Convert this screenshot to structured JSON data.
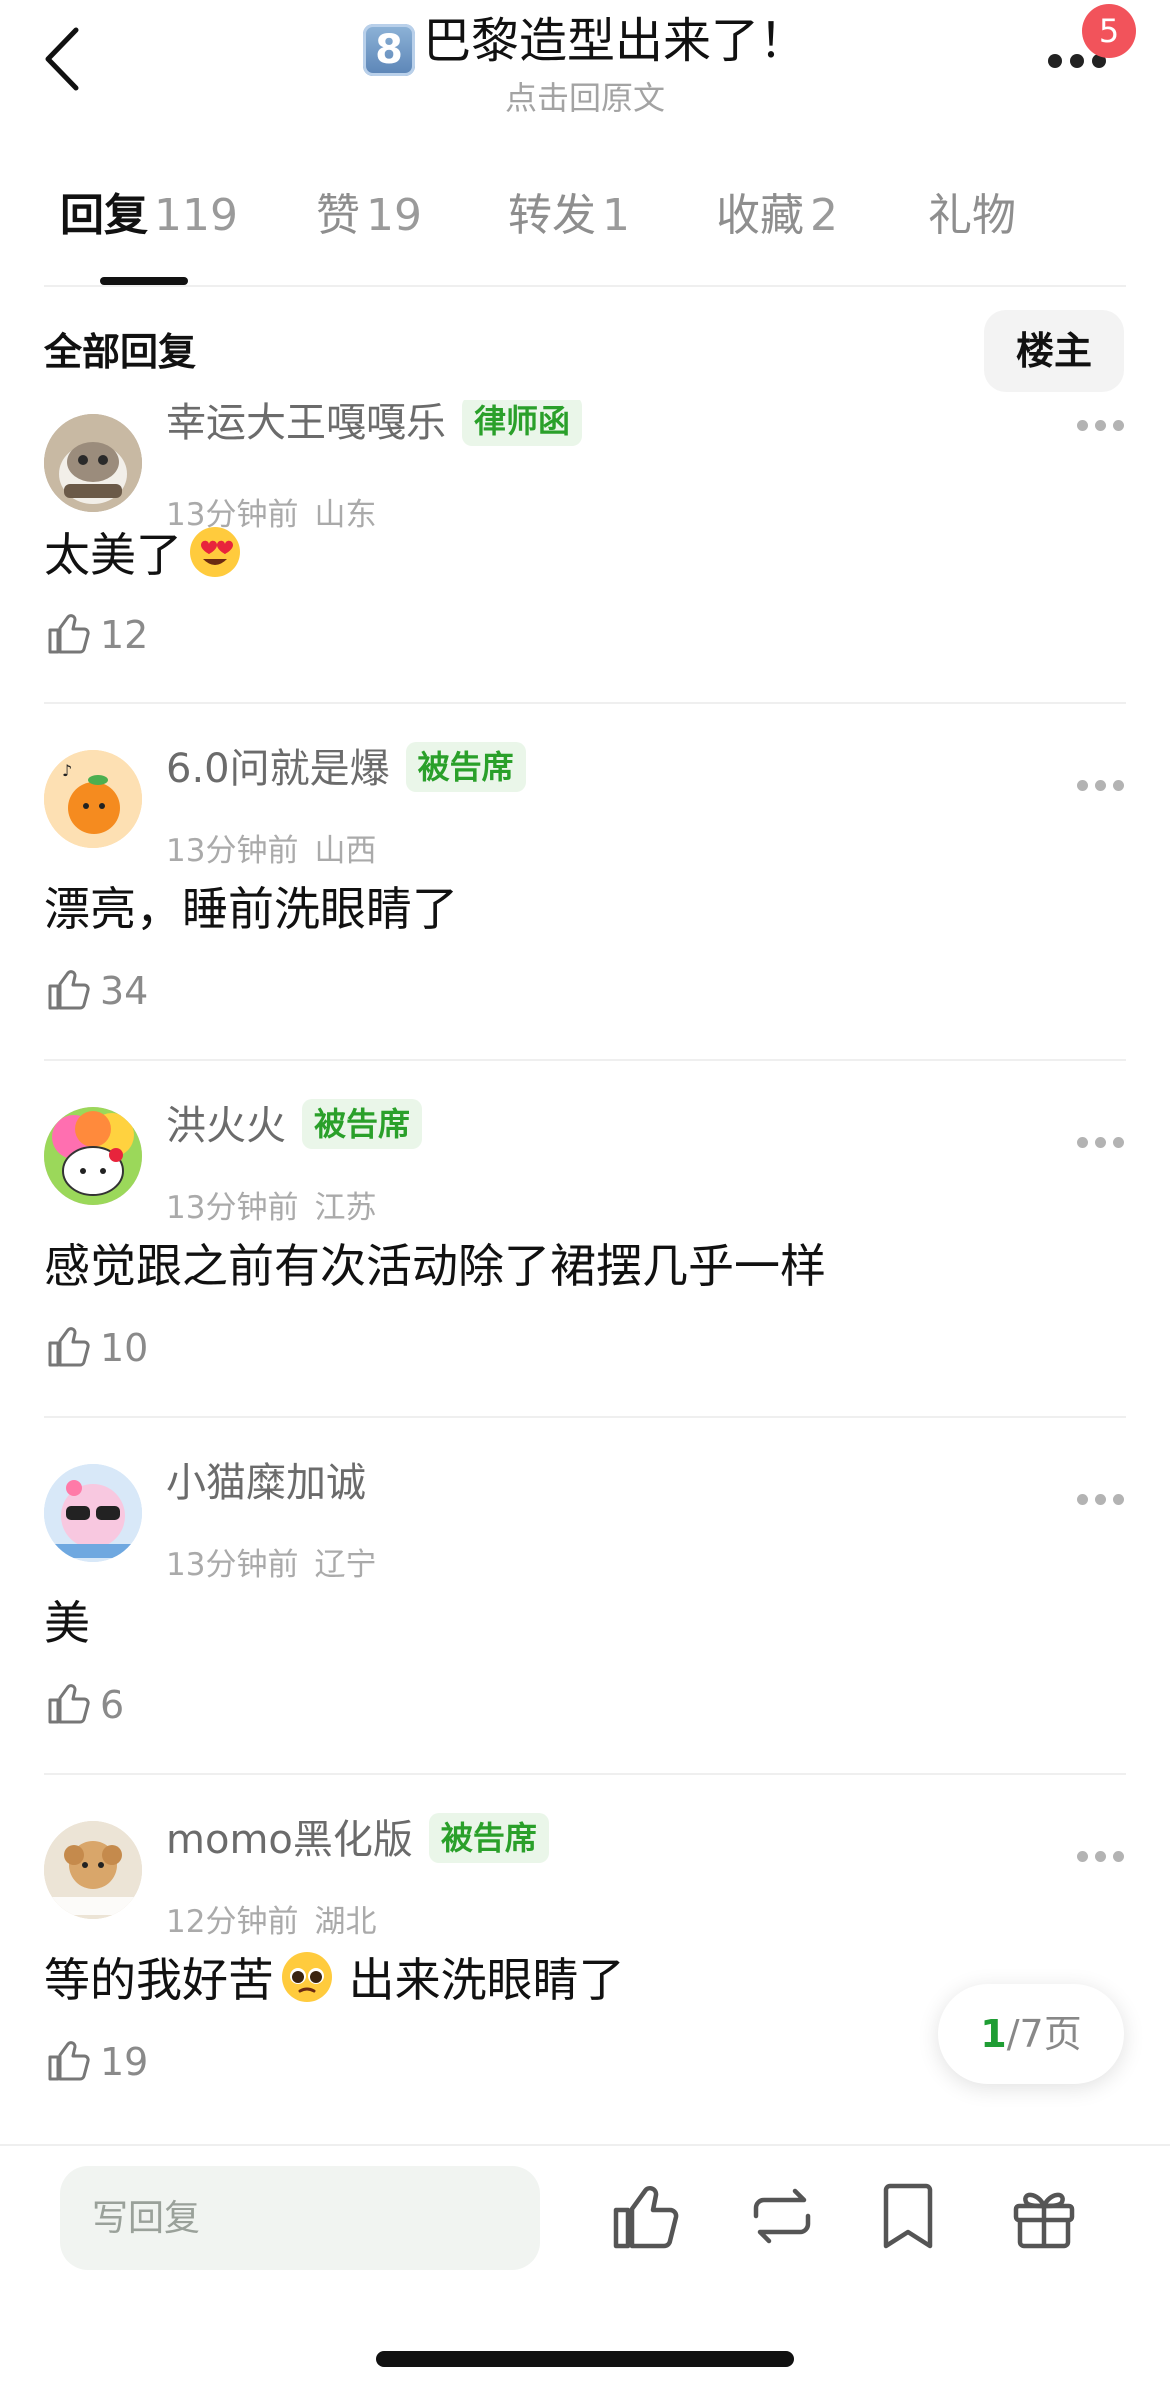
{
  "header": {
    "title_badge": "8",
    "title": "巴黎造型出来了！",
    "subtitle": "点击回原文",
    "notification_count": "5"
  },
  "tabs": [
    {
      "label": "回复",
      "count": "119",
      "active": true
    },
    {
      "label": "赞",
      "count": "19"
    },
    {
      "label": "转发",
      "count": "1"
    },
    {
      "label": "收藏",
      "count": "2"
    },
    {
      "label": "礼物",
      "count": ""
    }
  ],
  "filter": {
    "label": "全部回复",
    "owner_button": "楼主"
  },
  "comments": [
    {
      "name": "幸运大王嘎嘎乐",
      "tag": "律师函",
      "time": "13分钟前",
      "location": "山东",
      "text": "太美了",
      "emoji": "heart-eyes",
      "likes": "12"
    },
    {
      "name": "6.0问就是爆",
      "tag": "被告席",
      "time": "13分钟前",
      "location": "山西",
      "text": "漂亮，睡前洗眼睛了",
      "likes": "34"
    },
    {
      "name": "洪火火",
      "tag": "被告席",
      "time": "13分钟前",
      "location": "江苏",
      "text": "感觉跟之前有次活动除了裙摆几乎一样",
      "likes": "10"
    },
    {
      "name": "小猫糜加诚",
      "tag": "",
      "time": "13分钟前",
      "location": "辽宁",
      "text": "美",
      "likes": "6"
    },
    {
      "name": "momo黑化版",
      "tag": "被告席",
      "time": "12分钟前",
      "location": "湖北",
      "text_before": "等的我好苦",
      "emoji": "pleading",
      "text_after": "出来洗眼睛了",
      "likes": "19"
    }
  ],
  "pagination": {
    "current": "1",
    "rest": "/7页"
  },
  "bottom_bar": {
    "reply_placeholder": "写回复"
  },
  "colors": {
    "accent_green": "#1f9d34",
    "tag_green": "#2aa02a",
    "badge_red": "#f2535b"
  }
}
